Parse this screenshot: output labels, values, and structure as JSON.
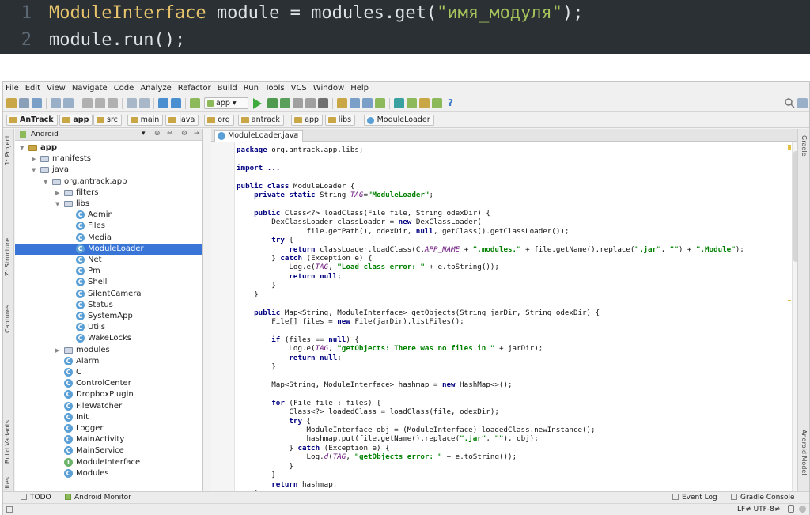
{
  "snippet": {
    "line1_no": "1",
    "line2_no": "2",
    "line1_type": "ModuleInterface",
    "line1_rest": " module = modules.get(",
    "line1_str": "\"имя_модуля\"",
    "line1_end": ");",
    "line2": "module.run();"
  },
  "menu": [
    "File",
    "Edit",
    "View",
    "Navigate",
    "Code",
    "Analyze",
    "Refactor",
    "Build",
    "Run",
    "Tools",
    "VCS",
    "Window",
    "Help"
  ],
  "toolbar": {
    "run_config": "app"
  },
  "breadcrumbs": [
    "AnTrack",
    "app",
    "src",
    "main",
    "java",
    "org",
    "antrack",
    "app",
    "libs",
    "ModuleLoader"
  ],
  "left_strip": [
    "1: Project",
    "Z: Structure",
    "Captures",
    "Build Variants",
    "2: Favorites"
  ],
  "right_strip": [
    "Gradle",
    "Android Model"
  ],
  "project": {
    "view": "Android",
    "tree": [
      {
        "label": "app",
        "depth": 0,
        "kind": "folder",
        "open": true
      },
      {
        "label": "manifests",
        "depth": 1,
        "kind": "folder",
        "open": false
      },
      {
        "label": "java",
        "depth": 1,
        "kind": "folder",
        "open": true
      },
      {
        "label": "org.antrack.app",
        "depth": 2,
        "kind": "folder",
        "open": true
      },
      {
        "label": "filters",
        "depth": 3,
        "kind": "folder",
        "open": false
      },
      {
        "label": "libs",
        "depth": 3,
        "kind": "folder",
        "open": true
      },
      {
        "label": "Admin",
        "depth": 4,
        "kind": "class"
      },
      {
        "label": "Files",
        "depth": 4,
        "kind": "class"
      },
      {
        "label": "Media",
        "depth": 4,
        "kind": "class"
      },
      {
        "label": "ModuleLoader",
        "depth": 4,
        "kind": "class",
        "selected": true
      },
      {
        "label": "Net",
        "depth": 4,
        "kind": "class"
      },
      {
        "label": "Pm",
        "depth": 4,
        "kind": "class"
      },
      {
        "label": "Shell",
        "depth": 4,
        "kind": "class"
      },
      {
        "label": "SilentCamera",
        "depth": 4,
        "kind": "class"
      },
      {
        "label": "Status",
        "depth": 4,
        "kind": "class"
      },
      {
        "label": "SystemApp",
        "depth": 4,
        "kind": "class"
      },
      {
        "label": "Utils",
        "depth": 4,
        "kind": "class"
      },
      {
        "label": "WakeLocks",
        "depth": 4,
        "kind": "class"
      },
      {
        "label": "modules",
        "depth": 3,
        "kind": "folder",
        "open": false
      },
      {
        "label": "Alarm",
        "depth": 3,
        "kind": "class"
      },
      {
        "label": "C",
        "depth": 3,
        "kind": "class"
      },
      {
        "label": "ControlCenter",
        "depth": 3,
        "kind": "class"
      },
      {
        "label": "DropboxPlugin",
        "depth": 3,
        "kind": "class"
      },
      {
        "label": "FileWatcher",
        "depth": 3,
        "kind": "class"
      },
      {
        "label": "Init",
        "depth": 3,
        "kind": "class"
      },
      {
        "label": "Logger",
        "depth": 3,
        "kind": "class"
      },
      {
        "label": "MainActivity",
        "depth": 3,
        "kind": "class"
      },
      {
        "label": "MainService",
        "depth": 3,
        "kind": "class"
      },
      {
        "label": "ModuleInterface",
        "depth": 3,
        "kind": "interface"
      },
      {
        "label": "Modules",
        "depth": 3,
        "kind": "class"
      }
    ]
  },
  "editor": {
    "tab": "ModuleLoader.java",
    "lines": [
      "<span class='kw'>package</span> org.antrack.app.libs;",
      "",
      "<span class='kw'>import</span> <span class='kw'>...</span>",
      "",
      "<span class='kw'>public class</span> ModuleLoader {",
      "    <span class='kw'>private static</span> String <span class='it'>TAG</span>=<span class='st'>\"ModuleLoader\"</span>;",
      "",
      "    <span class='kw'>public</span> Class&lt;?&gt; loadClass(File file, String odexDir) {",
      "        DexClassLoader classLoader = <span class='kw'>new</span> DexClassLoader(",
      "                file.getPath(), odexDir, <span class='kw'>null</span>, getClass().getClassLoader());",
      "        <span class='kw'>try</span> {",
      "            <span class='kw'>return</span> classLoader.loadClass(C.<span class='it'>APP_NAME</span> + <span class='st'>\".modules.\"</span> + file.getName().replace(<span class='st'>\".jar\"</span>, <span class='st'>\"\"</span>) + <span class='st'>\".Module\"</span>);",
      "        } <span class='kw'>catch</span> (Exception e) {",
      "            Log.e(<span class='it'>TAG</span>, <span class='st'>\"Load class error: \"</span> + e.toString());",
      "            <span class='kw'>return null</span>;",
      "        }",
      "    }",
      "",
      "    <span class='kw'>public</span> Map&lt;String, ModuleInterface&gt; getObjects(String jarDir, String odexDir) {",
      "        File[] files = <span class='kw'>new</span> File(jarDir).listFiles();",
      "",
      "        <span class='kw'>if</span> (files == <span class='kw'>null</span>) {",
      "            Log.e(<span class='it'>TAG</span>, <span class='st'>\"getObjects: There was no files in \"</span> + jarDir);",
      "            <span class='kw'>return null</span>;",
      "        }",
      "",
      "        Map&lt;String, ModuleInterface&gt; hashmap = <span class='kw'>new</span> HashMap&lt;&gt;();",
      "",
      "        <span class='kw'>for</span> (File file : files) {",
      "            Class&lt;?&gt; loadedClass = loadClass(file, odexDir);",
      "            <span class='kw'>try</span> {",
      "                ModuleInterface obj = (ModuleInterface) loadedClass.newInstance();",
      "                hashmap.put(file.getName().replace(<span class='st'>\".jar\"</span>, <span class='st'>\"\"</span>), obj);",
      "            } <span class='kw'>catch</span> (Exception e) {",
      "                Log.<span class='it'>d</span>(<span class='it'>TAG</span>, <span class='st'>\"getObjects error: \"</span> + e.toString());",
      "            }",
      "        }",
      "        <span class='kw'>return</span> hashmap;",
      "    }"
    ]
  },
  "bottom_tools": {
    "todo": "TODO",
    "monitor": "Android Monitor",
    "eventlog": "Event Log",
    "gradle_console": "Gradle Console"
  },
  "status": {
    "position": "LF≠ UTF-8≠"
  }
}
